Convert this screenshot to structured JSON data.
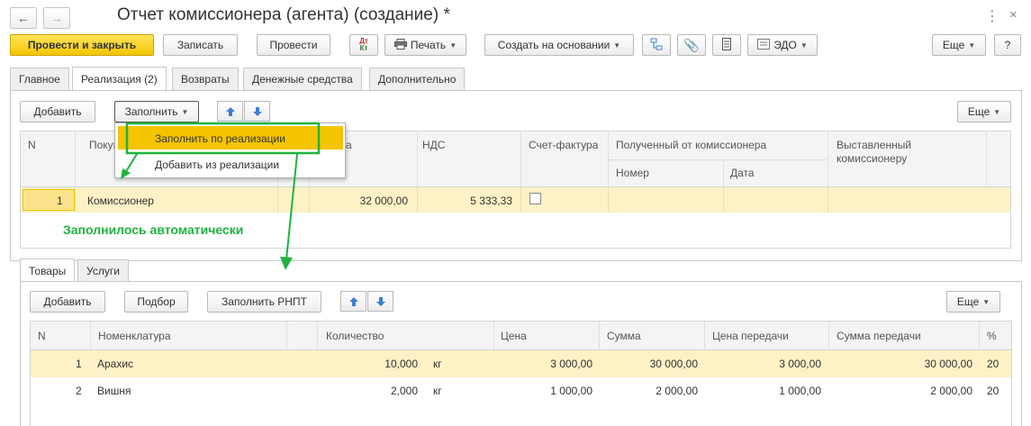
{
  "window": {
    "title": "Отчет комиссионера (агента) (создание) *"
  },
  "toolbar": {
    "post_close": "Провести и закрыть",
    "save": "Записать",
    "post": "Провести",
    "dt_kt": "Дт\nКт",
    "print": "Печать",
    "create_based": "Создать на основании",
    "edo": "ЭДО",
    "more": "Еще",
    "help": "?"
  },
  "tabs": [
    "Главное",
    "Реализация (2)",
    "Возвраты",
    "Денежные средства",
    "Дополнительно"
  ],
  "realization": {
    "add": "Добавить",
    "fill": "Заполнить",
    "more": "Еще",
    "dropdown": [
      "Заполнить по реализации",
      "Добавить из реализации"
    ],
    "columns": {
      "n": "N",
      "buyer": "Покупатель",
      "amount": "Сумма",
      "vat": "НДС",
      "invoice": "Счет-фактура",
      "received": "Полученный от комиссионера",
      "number": "Номер",
      "date": "Дата",
      "issued": "Выставленный комиссионеру"
    },
    "rows": [
      {
        "n": "1",
        "buyer": "Комиссионер",
        "amount": "32 000,00",
        "vat": "5 333,33"
      }
    ]
  },
  "annotation": "Заполнилось автоматически",
  "subtabs": [
    "Товары",
    "Услуги"
  ],
  "goods": {
    "add": "Добавить",
    "pick": "Подбор",
    "fill_rnpt": "Заполнить РНПТ",
    "more": "Еще",
    "columns": {
      "n": "N",
      "item": "Номенклатура",
      "qty": "Количество",
      "price": "Цена",
      "sum": "Сумма",
      "transfer_price": "Цена передачи",
      "transfer_sum": "Сумма передачи",
      "pct": "%"
    },
    "rows": [
      {
        "n": "1",
        "item": "Арахис",
        "qty": "10,000",
        "unit": "кг",
        "price": "3 000,00",
        "sum": "30 000,00",
        "transfer_price": "3 000,00",
        "transfer_sum": "30 000,00",
        "pct": "20"
      },
      {
        "n": "2",
        "item": "Вишня",
        "qty": "2,000",
        "unit": "кг",
        "price": "1 000,00",
        "sum": "2 000,00",
        "transfer_price": "1 000,00",
        "transfer_sum": "2 000,00",
        "pct": "20"
      }
    ]
  },
  "colors": {
    "accent_yellow": "#f5c400",
    "selected_row": "#fdf1c6",
    "annotation_green": "#1eb33f",
    "arrow_blue": "#3c7fd6"
  }
}
